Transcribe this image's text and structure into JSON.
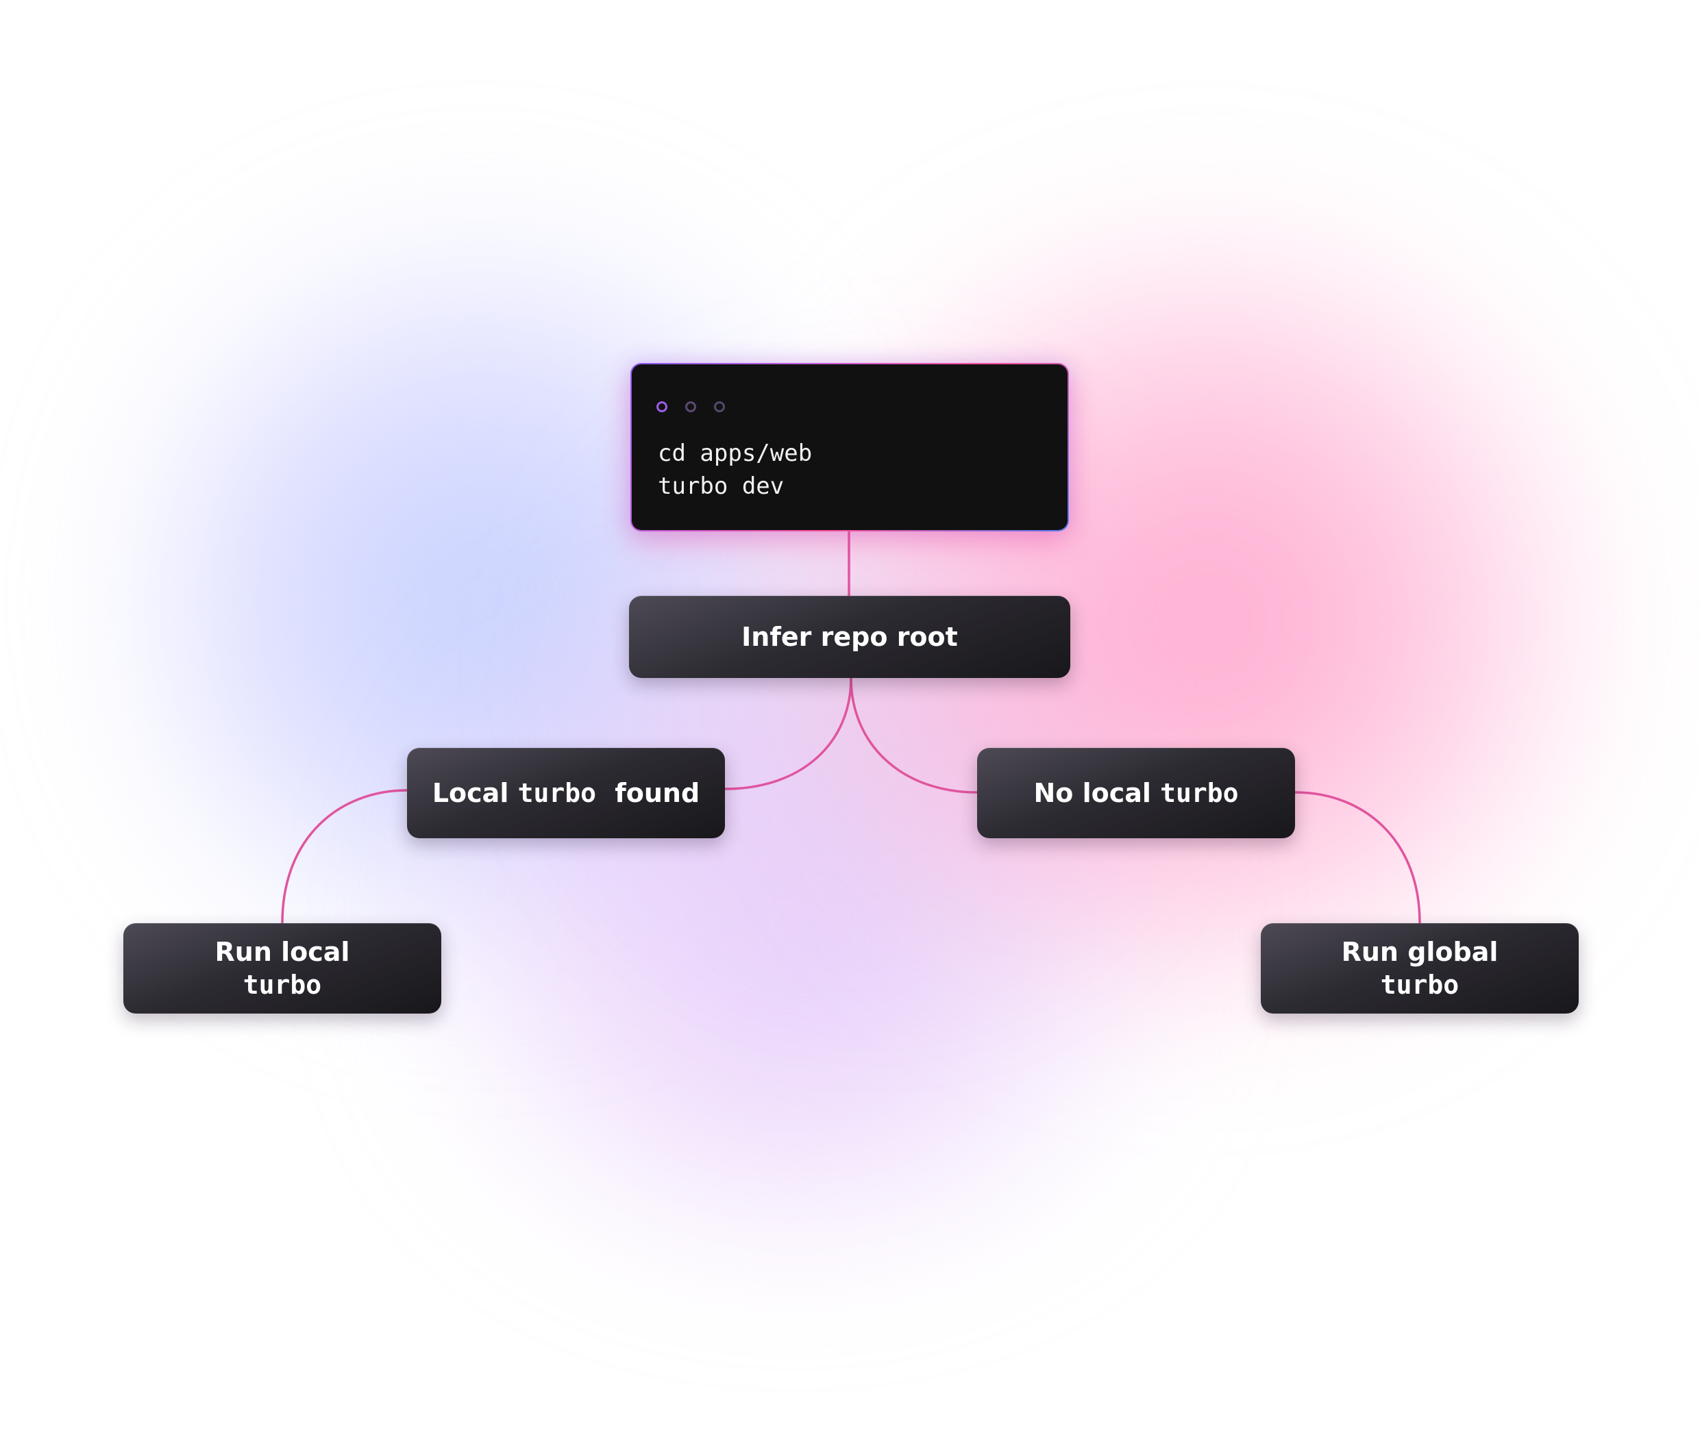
{
  "terminal": {
    "line1": "cd apps/web",
    "line2": "turbo dev"
  },
  "nodes": {
    "infer": "Infer repo root",
    "local_found": {
      "pre": "Local",
      "code": "turbo",
      "post": "found"
    },
    "no_local": {
      "pre": "No local",
      "code": "turbo"
    },
    "run_local": {
      "line1": "Run local",
      "line2": "turbo"
    },
    "run_global": {
      "line1": "Run global",
      "line2": "turbo"
    }
  },
  "colors": {
    "connector": "#e0559e",
    "node_dark": "#1c1b20",
    "terminal_bg": "#111111"
  }
}
